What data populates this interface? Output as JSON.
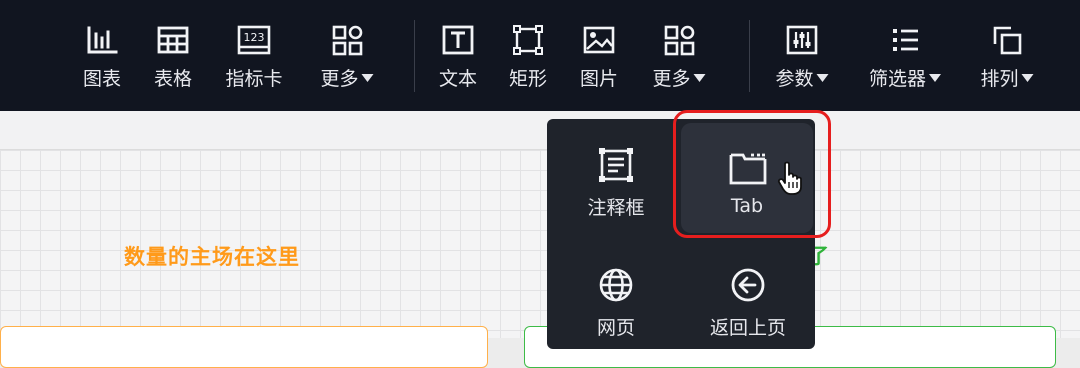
{
  "toolbar": {
    "items": [
      {
        "label": "图表",
        "icon": "bar-chart-icon",
        "dropdown": false
      },
      {
        "label": "表格",
        "icon": "table-icon",
        "dropdown": false
      },
      {
        "label": "指标卡",
        "icon": "indicator-card-icon",
        "icon_text": "123",
        "dropdown": false
      },
      {
        "label": "更多",
        "icon": "grid-more-icon",
        "dropdown": true
      },
      {
        "label": "文本",
        "icon": "text-icon",
        "dropdown": false
      },
      {
        "label": "矩形",
        "icon": "rectangle-icon",
        "dropdown": false
      },
      {
        "label": "图片",
        "icon": "image-icon",
        "dropdown": false
      },
      {
        "label": "更多",
        "icon": "grid-more-icon",
        "dropdown": true
      },
      {
        "label": "参数",
        "icon": "parameter-icon",
        "dropdown": true
      },
      {
        "label": "筛选器",
        "icon": "filter-list-icon",
        "dropdown": true
      },
      {
        "label": "排列",
        "icon": "arrange-icon",
        "dropdown": true
      }
    ]
  },
  "canvas": {
    "orange_text": "数量的主场在这里",
    "green_text_fragment": "了"
  },
  "dropdown": {
    "items": [
      {
        "label": "注释框",
        "icon": "annotation-box-icon"
      },
      {
        "label": "Tab",
        "icon": "tab-folder-icon",
        "hovered": true
      },
      {
        "label": "网页",
        "icon": "globe-icon"
      },
      {
        "label": "返回上页",
        "icon": "back-arrow-circle-icon"
      }
    ]
  },
  "colors": {
    "toolbar_bg": "#111520",
    "dropdown_bg": "#1f232b",
    "highlight": "#e61e1e",
    "orange": "#ff9a1a",
    "green": "#2fb33a"
  }
}
